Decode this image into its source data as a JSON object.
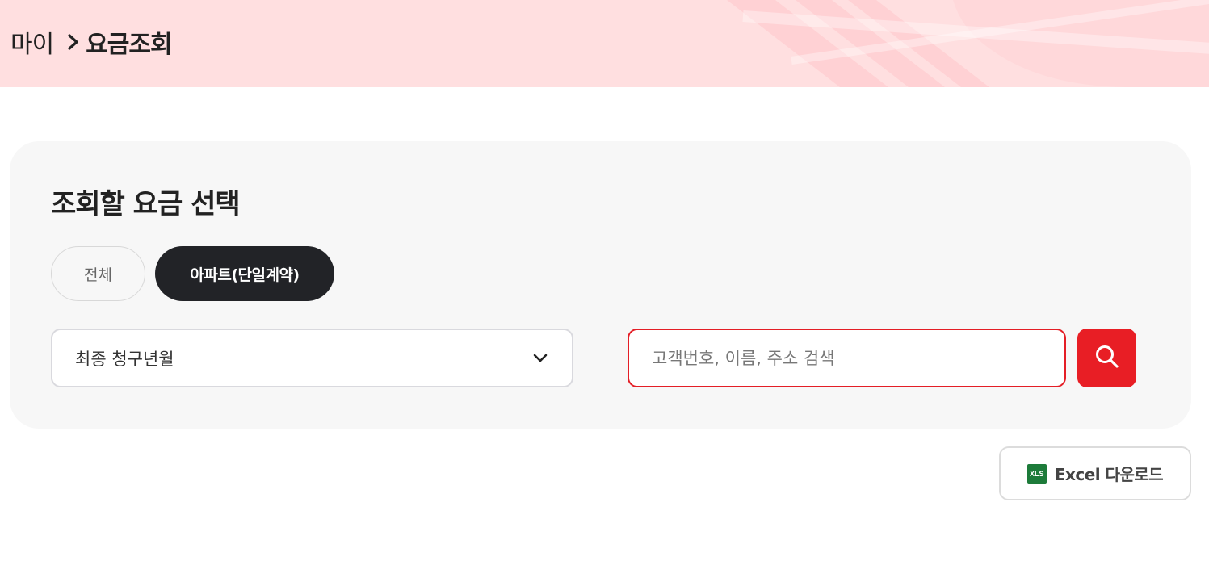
{
  "breadcrumb": {
    "parent": "마이",
    "current": "요금조회"
  },
  "panel": {
    "title": "조회할 요금 선택",
    "tabs": [
      {
        "label": "전체",
        "active": false
      },
      {
        "label": "아파트(단일계약)",
        "active": true
      }
    ],
    "billing_select": {
      "value": "최종 청구년월"
    },
    "search": {
      "value": "",
      "placeholder": "고객번호, 이름, 주소 검색"
    }
  },
  "excel": {
    "icon_text": "XLS",
    "label": "Excel 다운로드"
  },
  "colors": {
    "header_bg": "#ffdfe0",
    "accent_red": "#e81e25",
    "active_tab_bg": "#222327",
    "excel_green": "#1d7b3a"
  },
  "icons": {
    "breadcrumb_sep": "chevron-right-icon",
    "select": "chevron-down-icon",
    "search": "search-icon",
    "excel": "xls-file-icon"
  }
}
